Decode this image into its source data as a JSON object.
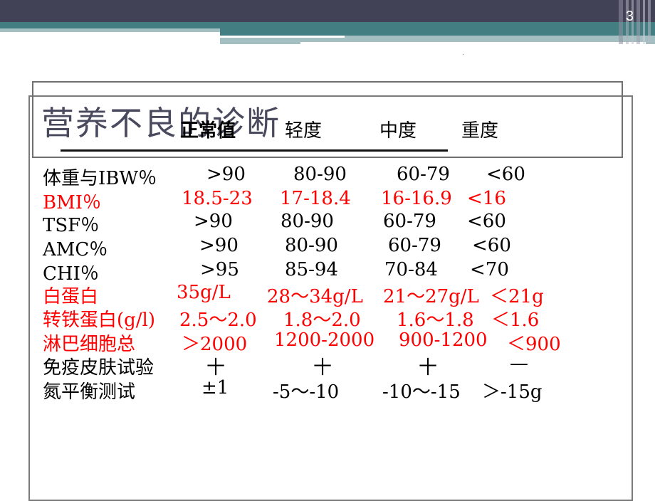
{
  "slide": {
    "page_number": "3",
    "title": "营养不良的诊断"
  },
  "theme": {
    "header_dark": "#424256",
    "header_teal": "#427e82",
    "header_light": "#a3bfc1",
    "highlight_red": "#ff0000",
    "text_black": "#000000",
    "title_gray": "#4a4a5e"
  },
  "table": {
    "columns": [
      "正常值",
      "轻度",
      "中度",
      "重度"
    ],
    "rows": [
      {
        "label": "体重与IBW％",
        "values": [
          ">90",
          "80-90",
          "60-79",
          "<60"
        ],
        "color": "black"
      },
      {
        "label": "BMI％",
        "values": [
          "18.5-23",
          "17-18.4",
          "16-16.9",
          "<16"
        ],
        "color": "red"
      },
      {
        "label": "TSF％",
        "values": [
          ">90",
          "80-90",
          "60-79",
          "<60"
        ],
        "color": "black"
      },
      {
        "label": "AMC％",
        "values": [
          ">90",
          "80-90",
          "60-79",
          "<60"
        ],
        "color": "black"
      },
      {
        "label": "CHI％",
        "values": [
          ">95",
          "85-94",
          "70-84",
          "<70"
        ],
        "color": "black"
      },
      {
        "label": "白蛋白",
        "values": [
          "35g/L",
          "28～34g/L",
          "21～27g/L",
          "＜21g"
        ],
        "color": "red"
      },
      {
        "label": "转铁蛋白(g/l)",
        "values": [
          "2.5～2.0",
          "1.8～2.0",
          "1.6～1.8",
          "＜1.6"
        ],
        "color": "red"
      },
      {
        "label": "淋巴细胞总",
        "values": [
          "＞2000",
          "1200-2000",
          "900-1200",
          "＜900"
        ],
        "color": "red"
      },
      {
        "label": "免疫皮肤试验",
        "values": [
          "十",
          "十",
          "十",
          "—"
        ],
        "color": "black"
      },
      {
        "label": "氮平衡测试",
        "values": [
          "±1",
          "-5～-10",
          "-10～-15",
          "＞-15g"
        ],
        "color": "black"
      }
    ]
  }
}
